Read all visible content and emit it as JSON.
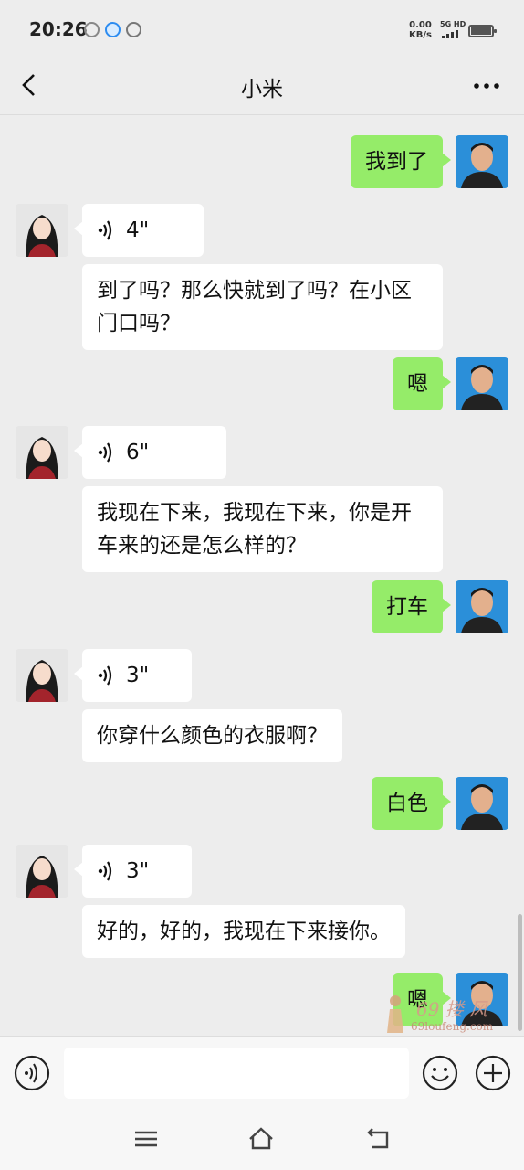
{
  "status_bar": {
    "time": "20:26",
    "net_speed_value": "0.00",
    "net_speed_unit": "KB/s",
    "signal_label": "5G HD"
  },
  "header": {
    "title": "小米"
  },
  "messages": [
    {
      "from": "me",
      "text": "我到了"
    },
    {
      "from": "them",
      "type": "voice",
      "duration": "4\""
    },
    {
      "from": "them",
      "text": "到了吗？那么快就到了吗？在小区门口吗？"
    },
    {
      "from": "me",
      "text": "嗯"
    },
    {
      "from": "them",
      "type": "voice",
      "duration": "6\""
    },
    {
      "from": "them",
      "text": "我现在下来，我现在下来，你是开车来的还是怎么样的？"
    },
    {
      "from": "me",
      "text": "打车"
    },
    {
      "from": "them",
      "type": "voice",
      "duration": "3\""
    },
    {
      "from": "them",
      "text": "你穿什么颜色的衣服啊？"
    },
    {
      "from": "me",
      "text": "白色"
    },
    {
      "from": "them",
      "type": "voice",
      "duration": "3\""
    },
    {
      "from": "them",
      "text": "好的，好的，我现在下来接你。"
    },
    {
      "from": "me",
      "text": "嗯"
    }
  ],
  "watermark": {
    "text": "69 搂 风",
    "url": "69loufeng.com"
  },
  "input_bar": {
    "value": ""
  },
  "icons": [
    "back-icon",
    "more-icon",
    "voice-input-icon",
    "emoji-icon",
    "plus-icon",
    "menu-nav-icon",
    "home-nav-icon",
    "back-nav-icon"
  ],
  "colors": {
    "mine_bubble": "#95ec69",
    "their_bubble": "#ffffff",
    "background": "#ededed"
  }
}
